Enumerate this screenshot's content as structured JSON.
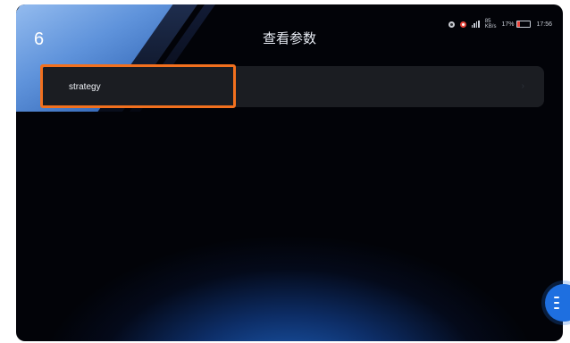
{
  "step_number": "6",
  "page_title": "查看参数",
  "status_bar": {
    "network_speed": "85",
    "speed_unit": "KB/s",
    "battery_percent": "17%",
    "battery_level": 0.17,
    "time": "17:56"
  },
  "list": {
    "items": [
      {
        "label": "strategy"
      }
    ]
  },
  "colors": {
    "highlight": "#f2701e",
    "fab": "#1e6fe0",
    "background": "#020308",
    "list_item_bg": "#1b1d22"
  },
  "icons": {
    "fab": "menu-icon",
    "list_item": "chevron-right-icon"
  }
}
